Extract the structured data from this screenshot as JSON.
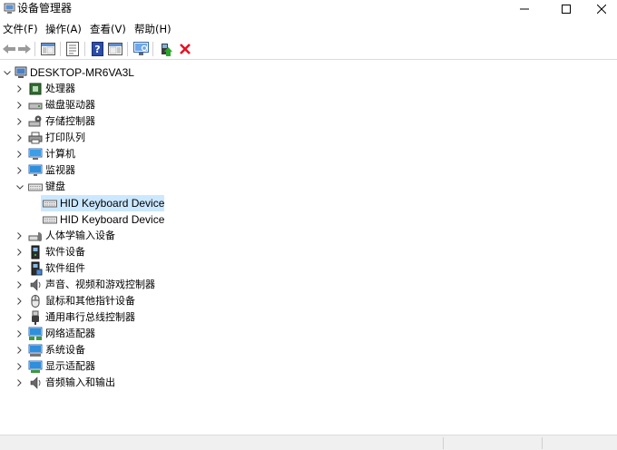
{
  "window": {
    "title": "设备管理器"
  },
  "menu": [
    "文件(F)",
    "操作(A)",
    "查看(V)",
    "帮助(H)"
  ],
  "toolbar": {
    "icons": [
      "back-arrow-icon",
      "forward-arrow-icon",
      "show-hide-console-tree-icon",
      "properties-icon",
      "help-icon",
      "action-pane-icon",
      "scan-hardware-changes-icon",
      "update-driver-icon",
      "uninstall-device-icon"
    ]
  },
  "tree": {
    "root": "DESKTOP-MR6VA3L",
    "categories": [
      {
        "label": "处理器",
        "icon": "processor-icon"
      },
      {
        "label": "磁盘驱动器",
        "icon": "disk-drive-icon"
      },
      {
        "label": "存储控制器",
        "icon": "storage-controller-icon"
      },
      {
        "label": "打印队列",
        "icon": "printer-icon"
      },
      {
        "label": "计算机",
        "icon": "computer-icon"
      },
      {
        "label": "监视器",
        "icon": "monitor-icon"
      },
      {
        "label": "键盘",
        "icon": "keyboard-icon",
        "expanded": true,
        "children": [
          "HID Keyboard Device",
          "HID Keyboard Device"
        ]
      },
      {
        "label": "人体学输入设备",
        "icon": "hid-icon"
      },
      {
        "label": "软件设备",
        "icon": "software-device-icon"
      },
      {
        "label": "软件组件",
        "icon": "software-component-icon"
      },
      {
        "label": "声音、视频和游戏控制器",
        "icon": "speaker-icon"
      },
      {
        "label": "鼠标和其他指针设备",
        "icon": "mouse-icon"
      },
      {
        "label": "通用串行总线控制器",
        "icon": "usb-icon"
      },
      {
        "label": "网络适配器",
        "icon": "network-adapter-icon"
      },
      {
        "label": "系统设备",
        "icon": "system-device-icon"
      },
      {
        "label": "显示适配器",
        "icon": "display-adapter-icon"
      },
      {
        "label": "音频输入和输出",
        "icon": "audio-io-icon"
      }
    ]
  },
  "colors": {
    "selection": "#cce8ff",
    "accent": "#1e6fd0",
    "uninstall": "#e81123"
  }
}
